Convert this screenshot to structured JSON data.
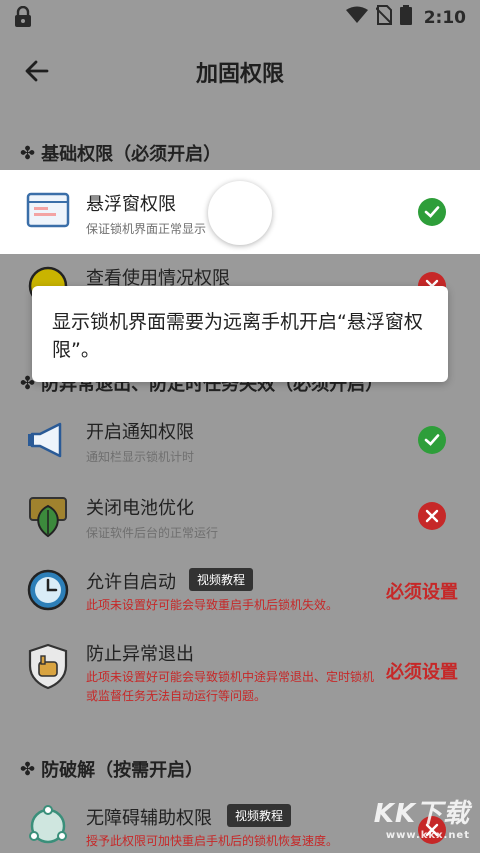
{
  "status_bar": {
    "time": "2:10",
    "icons": [
      "lock-icon",
      "wifi-icon",
      "no-sim-icon",
      "battery-icon"
    ]
  },
  "app_bar": {
    "title": "加固权限",
    "back_icon": "arrow-left-icon"
  },
  "sections": {
    "basic": "基础权限（必须开启）",
    "background": "防异常退出、防定时任务失效（必须开启）",
    "anti_crack": "防破解（按需开启）"
  },
  "rows": [
    {
      "label": "悬浮窗权限",
      "desc": "保证锁机界面正常显示",
      "state": "ok",
      "icon": "window-icon"
    },
    {
      "label": "查看使用情况权限",
      "desc": "",
      "state": "bad",
      "icon": "usage-icon"
    },
    {
      "label": "开启通知权限",
      "desc": "通知栏显示锁机计时",
      "state": "ok",
      "icon": "megaphone-icon"
    },
    {
      "label": "关闭电池优化",
      "desc": "保证软件后台的正常运行",
      "state": "bad",
      "icon": "battery-leaf-icon"
    },
    {
      "label": "允许自启动",
      "desc": "此项未设置好可能会导致重启手机后锁机失效。",
      "badge": "视频教程",
      "must": "必须设置",
      "icon": "clock-icon"
    },
    {
      "label": "防止异常退出",
      "desc": "此项未设置好可能会导致锁机中途异常退出、定时锁机或监督任务无法自动运行等问题。",
      "must": "必须设置",
      "icon": "shield-hand-icon"
    },
    {
      "label": "无障碍辅助权限",
      "desc": "授予此权限可加快重启手机后的锁机恢复速度。",
      "badge": "视频教程",
      "state": "bad",
      "icon": "accessibility-icon"
    }
  ],
  "toast": {
    "text": "显示锁机界面需要为远离手机开启“悬浮窗权限”。"
  },
  "watermark": {
    "brand": "KK下载",
    "url": "www.kkx.net"
  },
  "colors": {
    "ok": "#2e9e3a",
    "bad": "#c62828",
    "dim_overlay": "#9a9a9a"
  }
}
